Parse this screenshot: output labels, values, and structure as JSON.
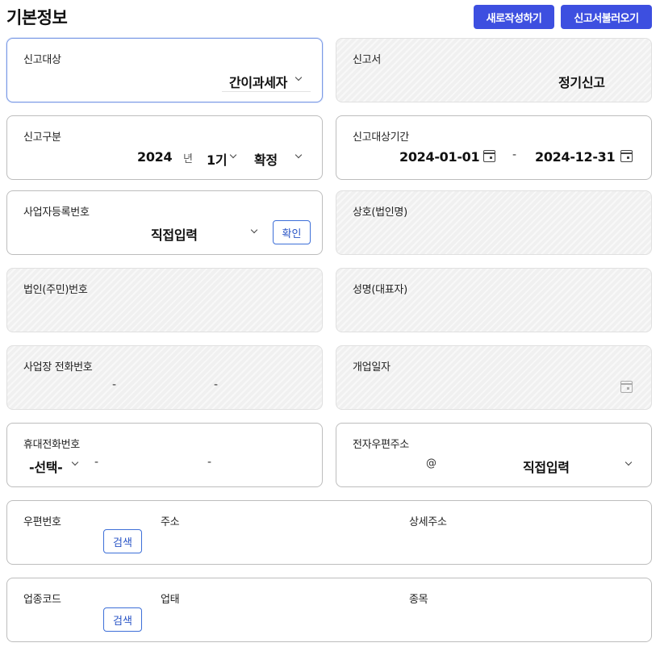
{
  "header": {
    "title": "기본정보",
    "btn_new": "새로작성하기",
    "btn_load": "신고서불러오기"
  },
  "report_target": {
    "label": "신고대상",
    "value": "간이과세자"
  },
  "report_form": {
    "label": "신고서",
    "value": "정기신고"
  },
  "report_type": {
    "label": "신고구분",
    "year": "2024",
    "year_unit": "년",
    "period": "1기",
    "status": "확정"
  },
  "report_period": {
    "label": "신고대상기간",
    "start": "2024-01-01",
    "sep": "-",
    "end": "2024-12-31"
  },
  "biz_reg_no": {
    "label": "사업자등록번호",
    "value": "직접입력",
    "confirm_btn": "확인"
  },
  "company_name": {
    "label": "상호(법인명)"
  },
  "corp_reg_no": {
    "label": "법인(주민)번호"
  },
  "rep_name": {
    "label": "성명(대표자)"
  },
  "biz_phone": {
    "label": "사업장 전화번호",
    "sep": "-"
  },
  "open_date": {
    "label": "개업일자"
  },
  "mobile": {
    "label": "휴대전화번호",
    "prefix": "-선택-",
    "sep": "-"
  },
  "email": {
    "label": "전자우편주소",
    "at": "@",
    "domain": "직접입력"
  },
  "address": {
    "zip_label": "우편번호",
    "search_btn": "검색",
    "addr_label": "주소",
    "detail_label": "상세주소"
  },
  "industry": {
    "code_label": "업종코드",
    "search_btn": "검색",
    "type_label": "업태",
    "item_label": "종목"
  }
}
